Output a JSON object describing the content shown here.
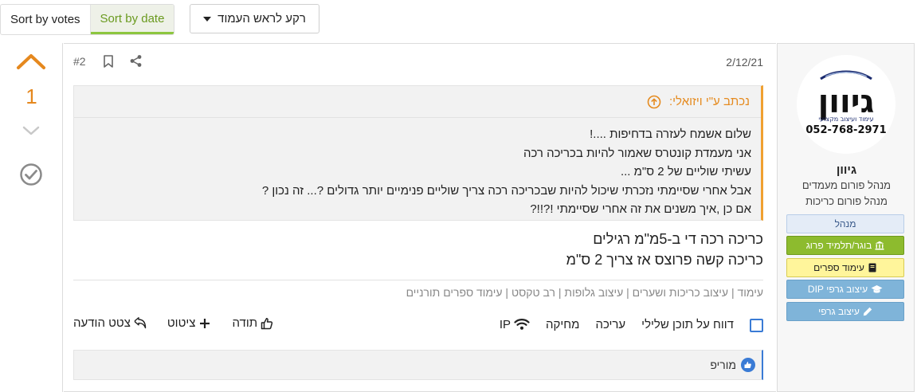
{
  "sort": {
    "votes_label": "Sort by votes",
    "date_label": "Sort by date",
    "active": "date"
  },
  "background_menu": {
    "label": "רקע לראש העמוד"
  },
  "vote": {
    "count": "1"
  },
  "post": {
    "number": "#2",
    "date": "2/12/21",
    "quote": {
      "author_line": "נכתב ע\"י ויזואלי:",
      "lines": [
        "שלום אשמח לעזרה בדחיפות ....!",
        "אני מעמדת קונטרס שאמור להיות בכריכה רכה",
        "עשיתי שוליים של 2 ס\"מ ...",
        "אבל אחרי שסיימתי נזכרתי שיכול להיות שבכריכה רכה צריך שוליים פנימיים יותר גדולים ?... זה נכון ?",
        "אם כן ,איך משנים את זה אחרי שסיימתי !?!!?"
      ]
    },
    "body_lines": [
      "כריכה רכה די ב-5מ\"מ רגילים",
      "כריכה קשה פרוצס אז צריך 2 ס\"מ"
    ],
    "signature": "עימוד | עיצוב כריכות ושערים | עיצוב גלופות | רב טקסט | עימוד ספרים תורניים",
    "actions_left": {
      "thanks": "תודה",
      "quote": "ציטוט",
      "quote_post": "צטט הודעה"
    },
    "actions_right": {
      "report": "דווח על תוכן שלילי",
      "edit": "עריכה",
      "delete": "מחיקה",
      "ip": "IP"
    },
    "likes": {
      "user": "מוריפ"
    }
  },
  "user": {
    "logo": {
      "name_text": "גיוון",
      "tagline": "עימוד ועיצוב מקצועי",
      "phone": "052-768-2971"
    },
    "name": "גיוון",
    "titles": [
      "מנהל פורום מעמדים",
      "מנהל פורום כריכות"
    ],
    "badges": {
      "admin": "מנהל",
      "grad": "בוגר/תלמיד פרוג",
      "books": "עימוד ספרים",
      "dip": "עיצוב גרפי DIP",
      "graphic": "עיצוב גרפי"
    }
  },
  "colors": {
    "vote_accent": "#e5881e",
    "sort_active": "#8dc63f",
    "quote_border": "#f0a030",
    "link_blue": "#3a7bd5"
  }
}
